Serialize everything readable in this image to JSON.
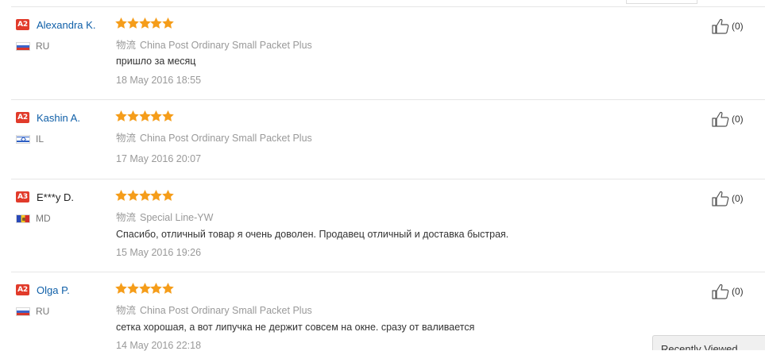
{
  "reviews": [
    {
      "badge": "A2",
      "name": "Alexandra K.",
      "name_is_link": true,
      "flag": "ru",
      "country": "RU",
      "stars": 5,
      "logistics_label": "物流",
      "logistics": "China Post Ordinary Small Packet Plus",
      "feedback": "пришло за месяц",
      "date": "18 May 2016 18:55",
      "helpful": "(0)"
    },
    {
      "badge": "A2",
      "name": "Kashin A.",
      "name_is_link": true,
      "flag": "il",
      "country": "IL",
      "stars": 5,
      "logistics_label": "物流",
      "logistics": "China Post Ordinary Small Packet Plus",
      "feedback": "",
      "date": "17 May 2016 20:07",
      "helpful": "(0)"
    },
    {
      "badge": "A3",
      "name": "E***y D.",
      "name_is_link": false,
      "flag": "md",
      "country": "MD",
      "stars": 5,
      "logistics_label": "物流",
      "logistics": "Special Line-YW",
      "feedback": "Спасибо, отличный товар я очень доволен. Продавец отличный и доставка быстрая.",
      "date": "15 May 2016 19:26",
      "helpful": "(0)"
    },
    {
      "badge": "A2",
      "name": "Olga P.",
      "name_is_link": true,
      "flag": "ru",
      "country": "RU",
      "stars": 5,
      "logistics_label": "物流",
      "logistics": "China Post Ordinary Small Packet Plus",
      "feedback": "сетка хорошая, а вот липучка не держит совсем на окне. сразу от валивается",
      "date": "14 May 2016 22:18",
      "helpful": "(0)"
    }
  ],
  "recently_viewed": "Recently Viewed",
  "colors": {
    "badge": "#e13b2b",
    "link": "#0f5fa8",
    "star": "#f59d1a",
    "muted": "#999999"
  },
  "icons": {
    "rating": "star-icon",
    "helpful": "thumbs-up-icon"
  }
}
